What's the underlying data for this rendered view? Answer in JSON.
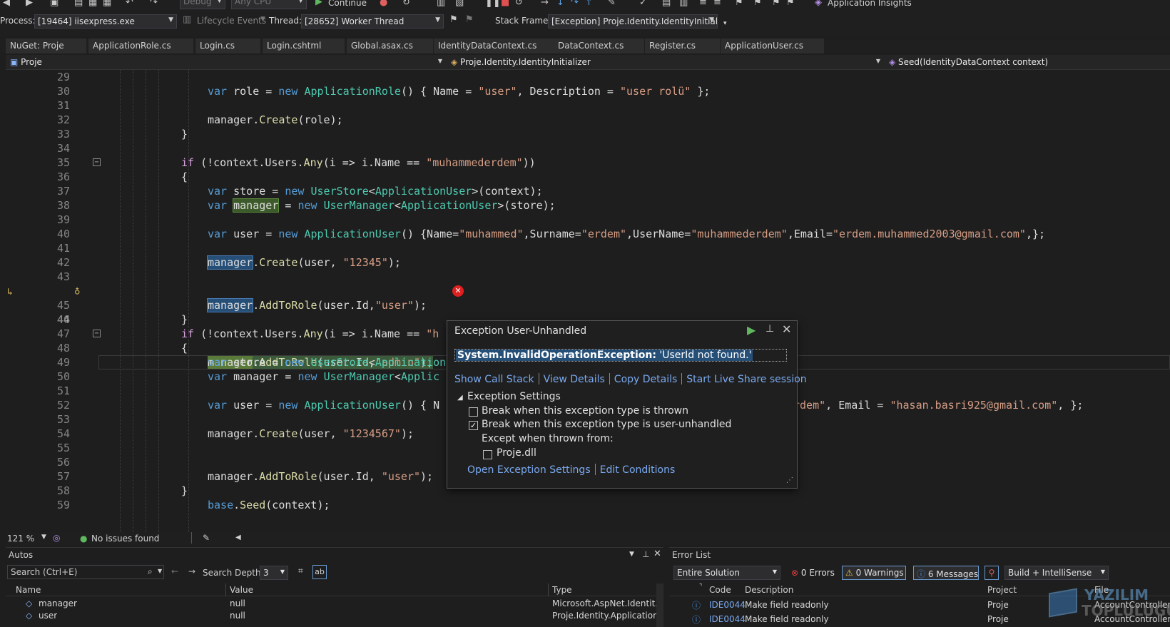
{
  "toolbar": {
    "config": "Debug",
    "platform": "Any CPU",
    "continue_label": "Continue",
    "app_insights": "Application Insights",
    "process_label": "Process:",
    "process_value": "[19464] iisexpress.exe",
    "lifecycle_label": "Lifecycle Events",
    "thread_label": "Thread:",
    "thread_value": "[28652] Worker Thread",
    "stack_frame_label": "Stack Frame:",
    "stack_frame_value": "[Exception] Proje.Identity.IdentityInitialize"
  },
  "tabs": [
    {
      "label": "NuGet: Proje"
    },
    {
      "label": "ApplicationRole.cs"
    },
    {
      "label": "Login.cs"
    },
    {
      "label": "Login.cshtml"
    },
    {
      "label": "Global.asax.cs"
    },
    {
      "label": "IdentityDataContext.cs"
    },
    {
      "label": "DataContext.cs"
    },
    {
      "label": "Register.cs"
    },
    {
      "label": "ApplicationUser.cs"
    }
  ],
  "navbar": {
    "project": "Proje",
    "class": "Proje.Identity.IdentityInitializer",
    "member": "Seed(IdentityDataContext context)"
  },
  "editor": {
    "line_numbers": [
      "29",
      "30",
      "31",
      "32",
      "33",
      "34",
      "35",
      "36",
      "37",
      "38",
      "39",
      "40",
      "41",
      "42",
      "43",
      "44",
      "45",
      "46",
      "47",
      "48",
      "49",
      "50",
      "51",
      "52",
      "53",
      "54",
      "55",
      "56",
      "57",
      "58",
      "59"
    ]
  },
  "exception": {
    "title": "Exception User-Unhandled",
    "type": "System.InvalidOperationException:",
    "message": " 'UserId not found.'",
    "show_call_stack": "Show Call Stack",
    "view_details": "View Details",
    "copy_details": "Copy Details",
    "live_share": "Start Live Share session",
    "settings_header": "Exception Settings",
    "break_thrown": "Break when this exception type is thrown",
    "break_unhandled": "Break when this exception type is user-unhandled",
    "except_from": "Except when thrown from:",
    "dll": "Proje.dll",
    "open_settings": "Open Exception Settings",
    "edit_conditions": "Edit Conditions"
  },
  "status": {
    "zoom": "121 %",
    "issues": "No issues found"
  },
  "autos": {
    "title": "Autos",
    "search_placeholder": "Search (Ctrl+E)",
    "search_depth_label": "Search Depth:",
    "search_depth": "3",
    "columns": [
      "Name",
      "Value",
      "Type"
    ],
    "rows": [
      {
        "name": "manager",
        "value": "null",
        "type": "Microsoft.AspNet.Identit..."
      },
      {
        "name": "user",
        "value": "null",
        "type": "Proje.Identity.Application..."
      }
    ]
  },
  "errors": {
    "title": "Error List",
    "scope": "Entire Solution",
    "errors_count": "0 Errors",
    "warnings_count": "0 Warnings",
    "messages_count": "6 Messages",
    "build_filter": "Build + IntelliSense",
    "columns": [
      "Code",
      "Description",
      "Project",
      "File"
    ],
    "rows": [
      {
        "code": "IDE0044",
        "description": "Make field readonly",
        "project": "Proje",
        "file": "AccountController.cs"
      },
      {
        "code": "IDE0044",
        "description": "Make field readonly",
        "project": "Proje",
        "file": "AccountController.cs"
      }
    ]
  },
  "watermark": {
    "line1": "YAZILIM",
    "line2": "TOPLULUĞU"
  }
}
